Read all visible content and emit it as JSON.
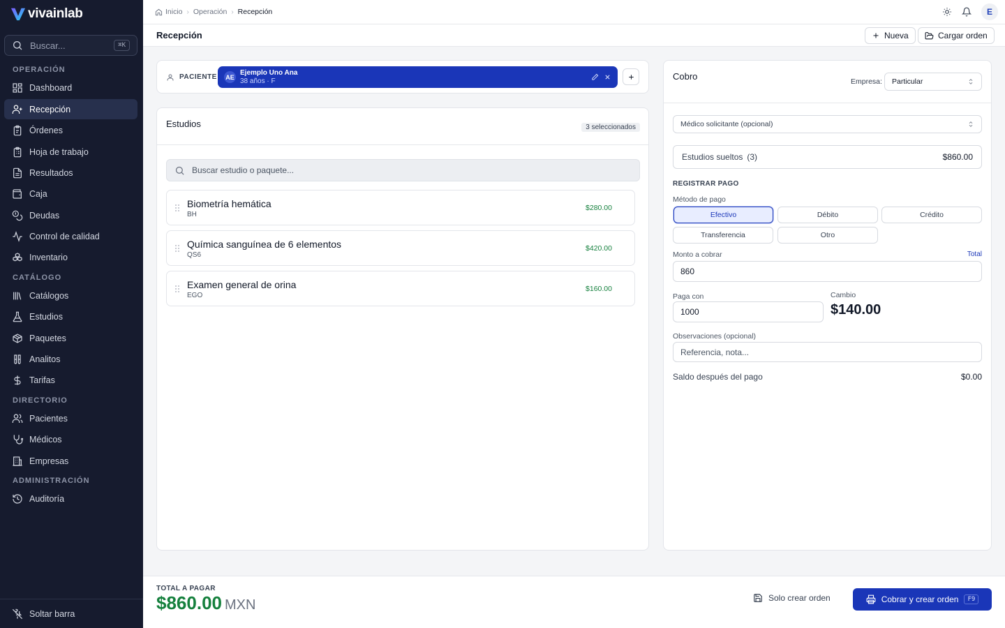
{
  "brand": {
    "name": "vivainlab"
  },
  "sidebar": {
    "search_placeholder": "Buscar...",
    "search_shortcut": "⌘K",
    "sections": [
      "OPERACIÓN",
      "CATÁLOGO",
      "DIRECTORIO",
      "ADMINISTRACIÓN"
    ],
    "items": [
      {
        "label": "Dashboard",
        "icon": "grid-icon"
      },
      {
        "label": "Recepción",
        "icon": "user-plus-icon",
        "active": true
      },
      {
        "label": "Órdenes",
        "icon": "clipboard-icon"
      },
      {
        "label": "Hoja de trabajo",
        "icon": "clipboard-list-icon"
      },
      {
        "label": "Resultados",
        "icon": "document-icon"
      },
      {
        "label": "Caja",
        "icon": "wallet-icon"
      },
      {
        "label": "Deudas",
        "icon": "coins-icon"
      },
      {
        "label": "Control de calidad",
        "icon": "activity-icon"
      },
      {
        "label": "Inventario",
        "icon": "boxes-icon"
      },
      {
        "label": "Catálogos",
        "icon": "library-icon"
      },
      {
        "label": "Estudios",
        "icon": "flask-icon"
      },
      {
        "label": "Paquetes",
        "icon": "package-icon"
      },
      {
        "label": "Analitos",
        "icon": "test-tubes-icon"
      },
      {
        "label": "Tarifas",
        "icon": "dollar-icon"
      },
      {
        "label": "Pacientes",
        "icon": "users-icon"
      },
      {
        "label": "Médicos",
        "icon": "stethoscope-icon"
      },
      {
        "label": "Empresas",
        "icon": "building-icon"
      },
      {
        "label": "Auditoría",
        "icon": "history-icon"
      }
    ],
    "unpin_label": "Soltar barra"
  },
  "topbar": {
    "breadcrumb": [
      "Inicio",
      "Operación",
      "Recepción"
    ],
    "user_initial": "E"
  },
  "page": {
    "title": "Recepción",
    "new_label": "Nueva",
    "load_order_label": "Cargar orden"
  },
  "patient": {
    "label": "PACIENTE",
    "initials": "AE",
    "name": "Ejemplo Uno Ana",
    "details": "38 años · F"
  },
  "studies": {
    "title": "Estudios",
    "selected_badge": "3 seleccionados",
    "search_placeholder": "Buscar estudio o paquete...",
    "items": [
      {
        "name": "Biometría hemática",
        "code": "BH",
        "price": "$280.00"
      },
      {
        "name": "Química sanguínea de 6 elementos",
        "code": "QS6",
        "price": "$420.00"
      },
      {
        "name": "Examen general de orina",
        "code": "EGO",
        "price": "$160.00"
      }
    ]
  },
  "billing": {
    "title": "Cobro",
    "company_label": "Empresa:",
    "company_value": "Particular",
    "doctor_placeholder": "Médico solicitante (opcional)",
    "loose_studies_label": "Estudios sueltos",
    "loose_studies_count": "(3)",
    "loose_studies_total": "$860.00",
    "register_payment": "REGISTRAR PAGO",
    "method_label": "Método de pago",
    "methods": [
      "Efectivo",
      "Débito",
      "Crédito",
      "Transferencia",
      "Otro"
    ],
    "selected_method": "Efectivo",
    "amount_label": "Monto a cobrar",
    "amount_total_link": "Total",
    "amount_value": "860",
    "pays_with_label": "Paga con",
    "pays_with_value": "1000",
    "change_label": "Cambio",
    "change_value": "$140.00",
    "notes_label": "Observaciones (opcional)",
    "notes_placeholder": "Referencia, nota...",
    "balance_label": "Saldo después del pago",
    "balance_value": "$0.00"
  },
  "footer": {
    "total_label": "TOTAL A PAGAR",
    "total_value": "$860.00",
    "currency": "MXN",
    "create_only_label": "Solo crear orden",
    "charge_create_label": "Cobrar y crear orden",
    "charge_shortcut": "F9"
  },
  "colors": {
    "sidebar_bg": "#161b2e",
    "primary": "#1a36b8",
    "total_green": "#15803d"
  }
}
